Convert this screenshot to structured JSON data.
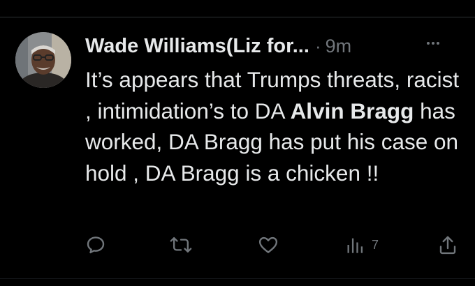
{
  "tweet": {
    "author_name": "Wade Williams(Liz for...",
    "separator": "·",
    "timestamp": "9m",
    "text_parts": {
      "p1": "It’s appears that Trumps threats, racist , intimidation’s to DA ",
      "mention": "Alvin Bragg",
      "p2": " has worked, DA Bragg has put his case on hold , DA Bragg is a chicken !!"
    },
    "views_count": "7"
  },
  "icons": {
    "more": "more-horizontal-icon",
    "reply": "reply-icon",
    "retweet": "retweet-icon",
    "like": "heart-icon",
    "views": "analytics-icon",
    "share": "share-icon"
  },
  "colors": {
    "background": "#000000",
    "text": "#e7e9ea",
    "secondary": "#71767b"
  }
}
